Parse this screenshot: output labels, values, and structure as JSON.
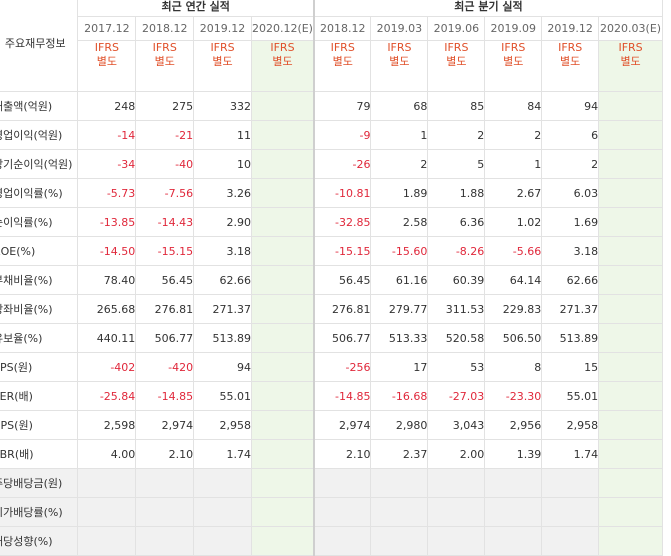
{
  "header": {
    "corner_label": "주요재무정보",
    "annual_group": "최근 연간 실적",
    "quarter_group": "최근 분기 실적",
    "annual_periods": [
      "2017.12",
      "2018.12",
      "2019.12",
      "2020.12(E)"
    ],
    "quarter_periods": [
      "2018.12",
      "2019.03",
      "2019.06",
      "2019.09",
      "2019.12",
      "2020.03(E)"
    ],
    "ifrs_line1": "IFRS",
    "ifrs_line2": "별도"
  },
  "rows": [
    {
      "label": "매출액(억원)",
      "annual": [
        "248",
        "275",
        "332",
        ""
      ],
      "quarter": [
        "79",
        "68",
        "85",
        "84",
        "94",
        ""
      ]
    },
    {
      "label": "영업이익(억원)",
      "annual": [
        "-14",
        "-21",
        "11",
        ""
      ],
      "quarter": [
        "-9",
        "1",
        "2",
        "2",
        "6",
        ""
      ]
    },
    {
      "label": "당기순이익(억원)",
      "annual": [
        "-34",
        "-40",
        "10",
        ""
      ],
      "quarter": [
        "-26",
        "2",
        "5",
        "1",
        "2",
        ""
      ]
    },
    {
      "label": "영업이익률(%)",
      "annual": [
        "-5.73",
        "-7.56",
        "3.26",
        ""
      ],
      "quarter": [
        "-10.81",
        "1.89",
        "1.88",
        "2.67",
        "6.03",
        ""
      ]
    },
    {
      "label": "순이익률(%)",
      "annual": [
        "-13.85",
        "-14.43",
        "2.90",
        ""
      ],
      "quarter": [
        "-32.85",
        "2.58",
        "6.36",
        "1.02",
        "1.69",
        ""
      ]
    },
    {
      "label": "ROE(%)",
      "annual": [
        "-14.50",
        "-15.15",
        "3.18",
        ""
      ],
      "quarter": [
        "-15.15",
        "-15.60",
        "-8.26",
        "-5.66",
        "3.18",
        ""
      ]
    },
    {
      "label": "부채비율(%)",
      "annual": [
        "78.40",
        "56.45",
        "62.66",
        ""
      ],
      "quarter": [
        "56.45",
        "61.16",
        "60.39",
        "64.14",
        "62.66",
        ""
      ]
    },
    {
      "label": "당좌비율(%)",
      "annual": [
        "265.68",
        "276.81",
        "271.37",
        ""
      ],
      "quarter": [
        "276.81",
        "279.77",
        "311.53",
        "229.83",
        "271.37",
        ""
      ]
    },
    {
      "label": "유보율(%)",
      "annual": [
        "440.11",
        "506.77",
        "513.89",
        ""
      ],
      "quarter": [
        "506.77",
        "513.33",
        "520.58",
        "506.50",
        "513.89",
        ""
      ]
    },
    {
      "label": "EPS(원)",
      "annual": [
        "-402",
        "-420",
        "94",
        ""
      ],
      "quarter": [
        "-256",
        "17",
        "53",
        "8",
        "15",
        ""
      ]
    },
    {
      "label": "PER(배)",
      "annual": [
        "-25.84",
        "-14.85",
        "55.01",
        ""
      ],
      "quarter": [
        "-14.85",
        "-16.68",
        "-27.03",
        "-23.30",
        "55.01",
        ""
      ]
    },
    {
      "label": "BPS(원)",
      "annual": [
        "2,598",
        "2,974",
        "2,958",
        ""
      ],
      "quarter": [
        "2,974",
        "2,980",
        "3,043",
        "2,956",
        "2,958",
        ""
      ]
    },
    {
      "label": "PBR(배)",
      "annual": [
        "4.00",
        "2.10",
        "1.74",
        ""
      ],
      "quarter": [
        "2.10",
        "2.37",
        "2.00",
        "1.39",
        "1.74",
        ""
      ]
    },
    {
      "label": "주당배당금(원)",
      "annual": [
        "",
        "",
        "",
        ""
      ],
      "quarter": [
        "",
        "",
        "",
        "",
        "",
        ""
      ]
    },
    {
      "label": "시가배당률(%)",
      "annual": [
        "",
        "",
        "",
        ""
      ],
      "quarter": [
        "",
        "",
        "",
        "",
        "",
        ""
      ]
    },
    {
      "label": "배당성향(%)",
      "annual": [
        "",
        "",
        "",
        ""
      ],
      "quarter": [
        "",
        "",
        "",
        "",
        "",
        ""
      ]
    }
  ],
  "colors": {
    "negative": "#e0283b",
    "ifrs": "#e0502a",
    "estimate_bg": "#eef7e8",
    "empty_bg": "#f1f1f1"
  }
}
